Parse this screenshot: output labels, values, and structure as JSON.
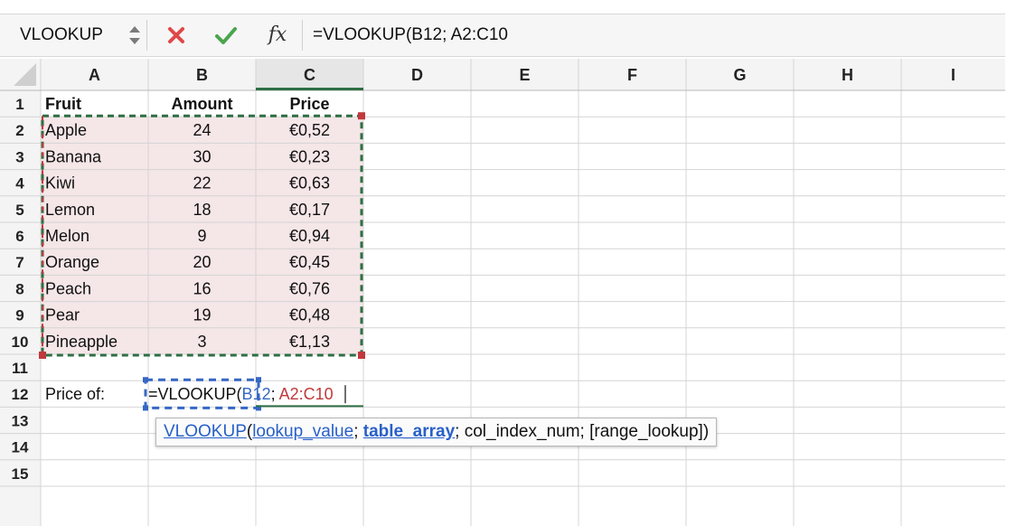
{
  "formula_bar": {
    "name_box": "VLOOKUP",
    "formula": "=VLOOKUP(B12; A2:C10"
  },
  "columns": [
    "A",
    "B",
    "C",
    "D",
    "E",
    "F",
    "G",
    "H",
    "I"
  ],
  "rows": [
    "1",
    "2",
    "3",
    "4",
    "5",
    "6",
    "7",
    "8",
    "9",
    "10",
    "11",
    "12",
    "13",
    "14",
    "15"
  ],
  "table": {
    "headers": [
      "Fruit",
      "Amount",
      "Price"
    ],
    "data": [
      [
        "Apple",
        "24",
        "€0,52"
      ],
      [
        "Banana",
        "30",
        "€0,23"
      ],
      [
        "Kiwi",
        "22",
        "€0,63"
      ],
      [
        "Lemon",
        "18",
        "€0,17"
      ],
      [
        "Melon",
        "9",
        "€0,94"
      ],
      [
        "Orange",
        "20",
        "€0,45"
      ],
      [
        "Peach",
        "16",
        "€0,76"
      ],
      [
        "Pear",
        "19",
        "€0,48"
      ],
      [
        "Pineapple",
        "3",
        "€1,13"
      ]
    ]
  },
  "cells": {
    "a12": "Price of:",
    "edit": {
      "prefix": "=VLOOKUP(",
      "ref1": "B12",
      "sep": "; ",
      "ref2": "A2:C10"
    }
  },
  "tooltip": {
    "fn": "VLOOKUP",
    "open": "(",
    "arg1": "lookup_value",
    "sep1": "; ",
    "arg2": "table_array",
    "sep2": "; ",
    "arg3": "col_index_num",
    "sep3": "; ",
    "arg4": "[range_lookup]",
    "close": ")"
  },
  "colors": {
    "range_fill": "#f5e6e8",
    "range_red": "#c0393b",
    "range_green": "#2e6e43",
    "ref_blue": "#3567c4",
    "ref_red": "#c0393b",
    "active_col": "#2e6e43",
    "cancel": "#e04848",
    "confirm": "#4aa54d"
  },
  "icons": {
    "name_box_stepper": "up-down-stepper-icon",
    "cancel": "x-mark-icon",
    "confirm": "check-mark-icon",
    "insert_function": "fx-icon"
  }
}
